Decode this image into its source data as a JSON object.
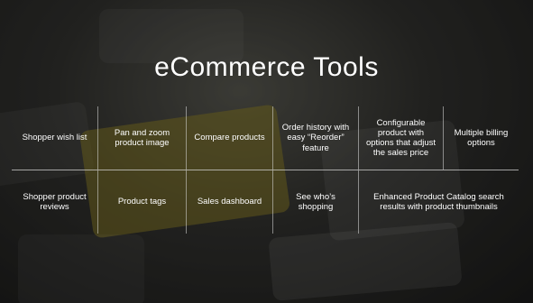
{
  "title": "eCommerce Tools",
  "features": {
    "row1": [
      "Shopper wish list",
      "Pan and zoom product image",
      "Compare products",
      "Order history with easy “Reorder” feature",
      "Configurable product with options that adjust the sales price",
      "Multiple billing options"
    ],
    "row2": [
      "Shopper product reviews",
      "Product tags",
      "Sales dashboard",
      "See who’s shopping",
      "Enhanced Product Catalog search results with product thumbnails"
    ]
  }
}
